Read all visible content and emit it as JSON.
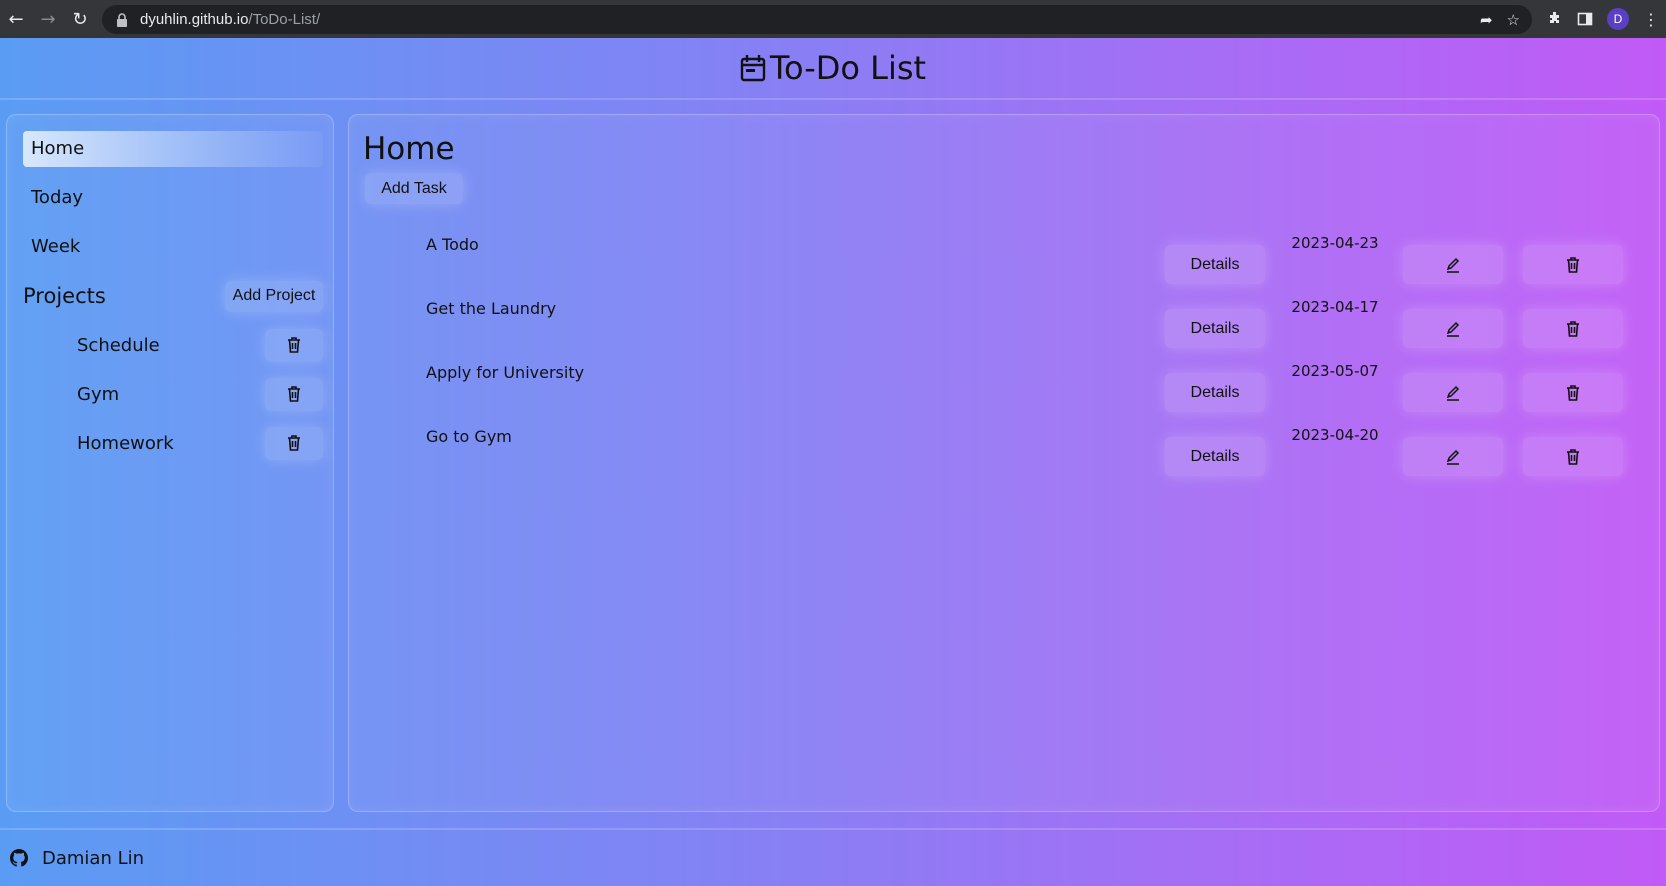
{
  "browser": {
    "url_host": "dyuhlin.github.io",
    "url_path": "/ToDo-List/",
    "profile_initial": "D"
  },
  "header": {
    "title": "To-Do List"
  },
  "sidebar": {
    "nav": [
      {
        "label": "Home",
        "active": true
      },
      {
        "label": "Today",
        "active": false
      },
      {
        "label": "Week",
        "active": false
      }
    ],
    "projects_title": "Projects",
    "add_project_label": "Add Project",
    "projects": [
      {
        "name": "Schedule"
      },
      {
        "name": "Gym"
      },
      {
        "name": "Homework"
      }
    ]
  },
  "main": {
    "title": "Home",
    "add_task_label": "Add Task",
    "details_label": "Details",
    "tasks": [
      {
        "title": "A Todo",
        "date": "2023-04-23"
      },
      {
        "title": "Get the Laundry",
        "date": "2023-04-17"
      },
      {
        "title": "Apply for University",
        "date": "2023-05-07"
      },
      {
        "title": "Go to Gym",
        "date": "2023-04-20"
      }
    ]
  },
  "footer": {
    "author": "Damian Lin"
  },
  "colors": {
    "gradient_start": "#5a9cf4",
    "gradient_end": "#c15af6",
    "chrome_bg": "#35363a"
  }
}
